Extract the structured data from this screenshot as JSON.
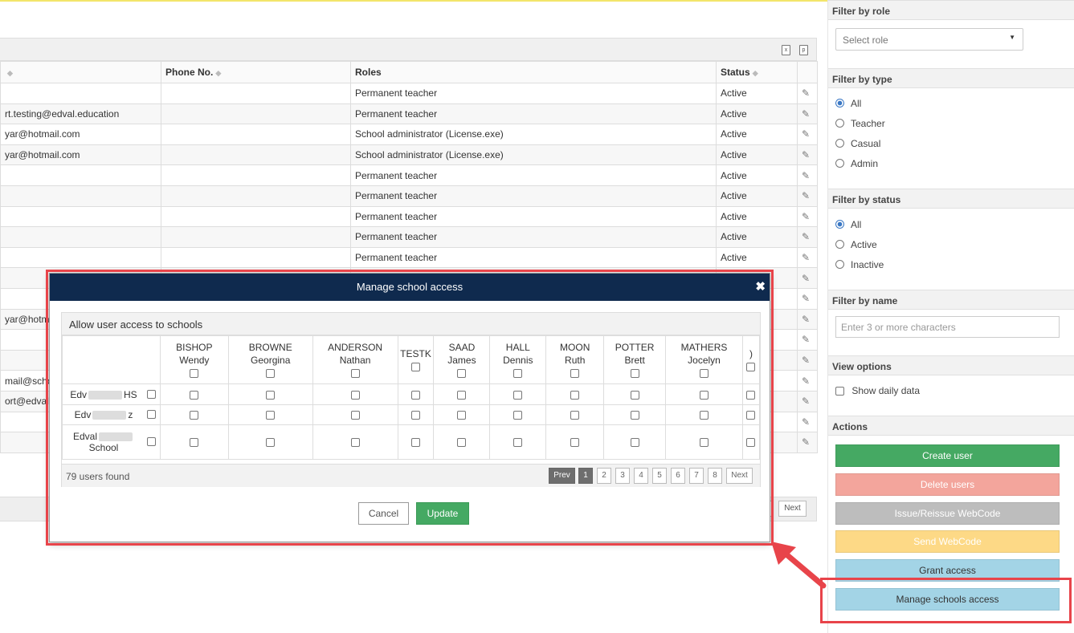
{
  "background_table": {
    "headers": {
      "phone": "Phone No.",
      "roles": "Roles",
      "status": "Status"
    },
    "rows": [
      {
        "email": "",
        "role": "Permanent teacher",
        "status": "Active"
      },
      {
        "email": "rt.testing@edval.education",
        "role": "Permanent teacher",
        "status": "Active"
      },
      {
        "email": "yar@hotmail.com",
        "role": "School administrator (License.exe)",
        "status": "Active"
      },
      {
        "email": "yar@hotmail.com",
        "role": "School administrator (License.exe)",
        "status": "Active"
      },
      {
        "email": "",
        "role": "Permanent teacher",
        "status": "Active"
      },
      {
        "email": "",
        "role": "Permanent teacher",
        "status": "Active"
      },
      {
        "email": "",
        "role": "Permanent teacher",
        "status": "Active"
      },
      {
        "email": "",
        "role": "Permanent teacher",
        "status": "Active"
      },
      {
        "email": "",
        "role": "Permanent teacher",
        "status": "Active"
      },
      {
        "email": "",
        "role": "",
        "status": ""
      },
      {
        "email": "",
        "role": "",
        "status": ""
      },
      {
        "email": "yar@hotm",
        "role": "",
        "status": ""
      },
      {
        "email": "",
        "role": "",
        "status": ""
      },
      {
        "email": "",
        "role": "",
        "status": ""
      },
      {
        "email": "mail@schoo",
        "role": "",
        "status": ""
      },
      {
        "email": "ort@edval.e",
        "role": "",
        "status": ""
      },
      {
        "email": "",
        "role": "",
        "status": ""
      },
      {
        "email": "",
        "role": "",
        "status": ""
      }
    ],
    "next_label": "Next"
  },
  "sidebar": {
    "filter_role": {
      "title": "Filter by role",
      "placeholder": "Select role"
    },
    "filter_type": {
      "title": "Filter by type",
      "options": [
        "All",
        "Teacher",
        "Casual",
        "Admin"
      ],
      "selected": "All"
    },
    "filter_status": {
      "title": "Filter by status",
      "options": [
        "All",
        "Active",
        "Inactive"
      ],
      "selected": "All"
    },
    "filter_name": {
      "title": "Filter by name",
      "placeholder": "Enter 3 or more characters"
    },
    "view_options": {
      "title": "View options",
      "show_daily": "Show daily data"
    },
    "actions": {
      "title": "Actions",
      "buttons": [
        {
          "label": "Create user",
          "color": "#45a963"
        },
        {
          "label": "Delete users",
          "color": "#f3a59c"
        },
        {
          "label": "Issue/Reissue WebCode",
          "color": "#bdbdbd"
        },
        {
          "label": "Send WebCode",
          "color": "#fdd986"
        },
        {
          "label": "Grant access",
          "color": "#a3d4e6"
        },
        {
          "label": "Manage schools access",
          "color": "#a3d4e6"
        }
      ]
    }
  },
  "modal": {
    "title": "Manage school access",
    "close": "✖",
    "section_title": "Allow user access to schools",
    "columns": [
      {
        "line1": "BISHOP",
        "line2": "Wendy"
      },
      {
        "line1": "BROWNE",
        "line2": "Georgina"
      },
      {
        "line1": "ANDERSON",
        "line2": "Nathan"
      },
      {
        "line1": "TESTK",
        "line2": ""
      },
      {
        "line1": "SAAD",
        "line2": "James"
      },
      {
        "line1": "HALL",
        "line2": "Dennis"
      },
      {
        "line1": "MOON",
        "line2": "Ruth"
      },
      {
        "line1": "POTTER",
        "line2": "Brett"
      },
      {
        "line1": "MATHERS",
        "line2": "Jocelyn"
      },
      {
        "line1": ")",
        "line2": ""
      }
    ],
    "schools": [
      {
        "prefix": "Edv",
        "suffix": "HS"
      },
      {
        "prefix": "Edv",
        "suffix": "z"
      },
      {
        "prefix": "Edval",
        "suffix": "School"
      }
    ],
    "users_found": "79 users found",
    "pagination": {
      "prev": "Prev",
      "pages": [
        "1",
        "2",
        "3",
        "4",
        "5",
        "6",
        "7",
        "8"
      ],
      "current": "1",
      "next": "Next"
    },
    "cancel": "Cancel",
    "update": "Update"
  },
  "colors": {
    "modal_header": "#0f2a4e",
    "update": "#45a963",
    "annotation": "#e8444a"
  }
}
